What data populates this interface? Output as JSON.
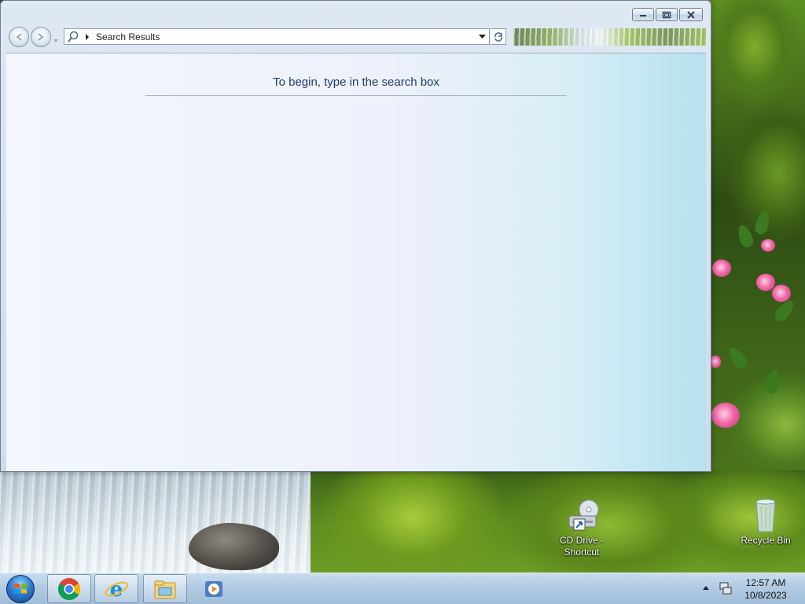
{
  "window": {
    "address": {
      "breadcrumb": "Search Results"
    },
    "content": {
      "empty_message": "To begin, type in the search box"
    }
  },
  "desktop": {
    "icons": [
      {
        "name": "CD Drive - Shortcut"
      },
      {
        "name": "Recycle Bin"
      }
    ]
  },
  "taskbar": {
    "pinned": [
      "chrome-icon",
      "internet-explorer-icon",
      "file-explorer-icon",
      "media-player-icon"
    ],
    "clock": {
      "time": "12:57 AM",
      "date": "10/8/2023"
    }
  }
}
